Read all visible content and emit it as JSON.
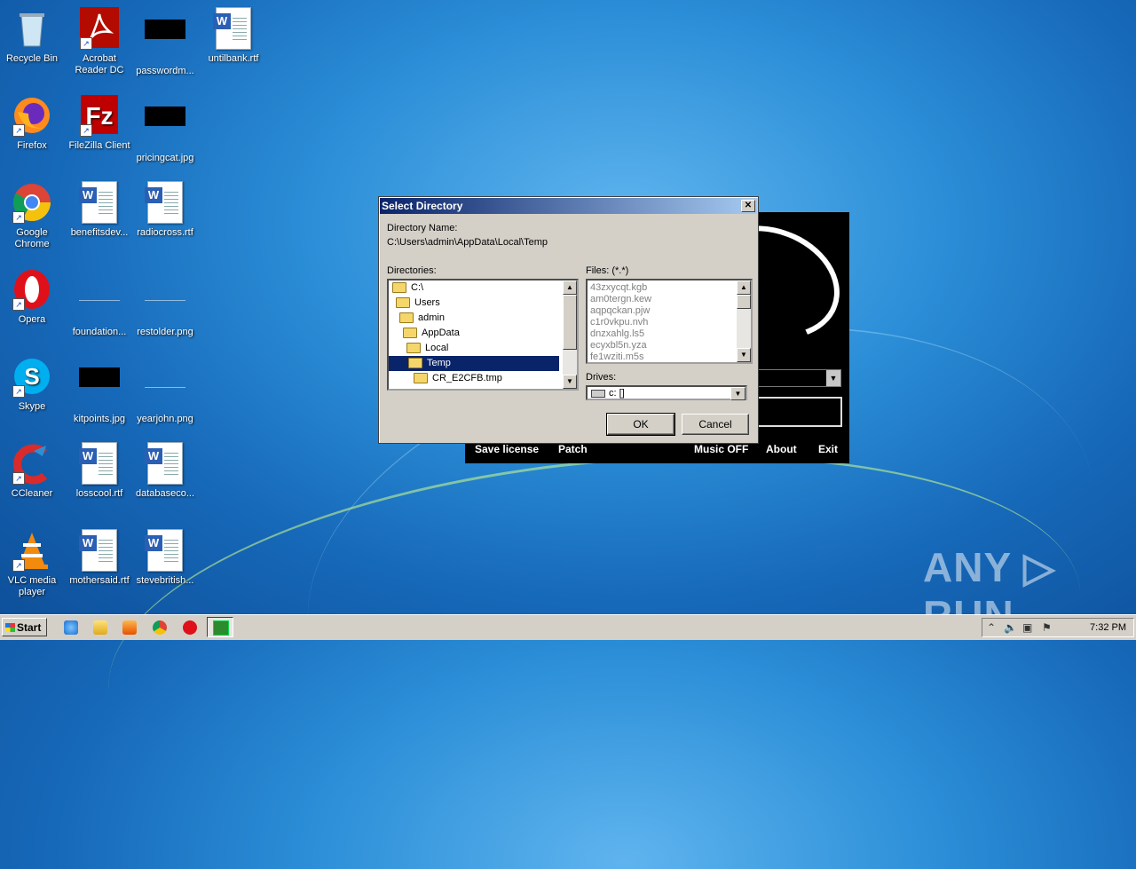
{
  "desktop": {
    "icons": [
      {
        "label": "Recycle Bin"
      },
      {
        "label": "Acrobat Reader DC"
      },
      {
        "label": "passwordm..."
      },
      {
        "label": "untilbank.rtf"
      },
      {
        "label": "Firefox"
      },
      {
        "label": "FileZilla Client"
      },
      {
        "label": "pricingcat.jpg"
      },
      {
        "label": "Google Chrome"
      },
      {
        "label": "benefitsdev..."
      },
      {
        "label": "radiocross.rtf"
      },
      {
        "label": "Opera"
      },
      {
        "label": "foundation..."
      },
      {
        "label": "restolder.png"
      },
      {
        "label": "Skype"
      },
      {
        "label": "kitpoints.jpg"
      },
      {
        "label": "yearjohn.png"
      },
      {
        "label": "CCleaner"
      },
      {
        "label": "losscool.rtf"
      },
      {
        "label": "databaseco..."
      },
      {
        "label": "VLC media player"
      },
      {
        "label": "mothersaid.rtf"
      },
      {
        "label": "stevebritish..."
      }
    ]
  },
  "patcher": {
    "buttons": {
      "save_license": "Save license",
      "patch": "Patch",
      "music": "Music OFF",
      "about": "About",
      "exit": "Exit"
    }
  },
  "dialog": {
    "title": "Select Directory",
    "close": "✕",
    "directory_name_label": "Directory Name:",
    "directory_path": "C:\\Users\\admin\\AppData\\Local\\Temp",
    "directories_label": "Directories:",
    "files_label": "Files: (*.*)",
    "drives_label": "Drives:",
    "directories": [
      {
        "name": "C:\\"
      },
      {
        "name": "Users"
      },
      {
        "name": "admin"
      },
      {
        "name": "AppData"
      },
      {
        "name": "Local"
      },
      {
        "name": "Temp"
      },
      {
        "name": "CR_E2CFB.tmp"
      }
    ],
    "selected_directory": "Temp",
    "files": [
      "43zxycqt.kgb",
      "am0tergn.kew",
      "aqpqckan.pjw",
      "c1r0vkpu.nvh",
      "dnzxahlg.ls5",
      "ecyxbl5n.yza",
      "fe1wziti.m5s"
    ],
    "drive_value": "c: []",
    "ok": "OK",
    "cancel": "Cancel"
  },
  "taskbar": {
    "start": "Start",
    "clock": "7:32 PM",
    "quick_launch": [
      "internet-explorer-icon",
      "explorer-icon",
      "media-player-icon",
      "chrome-icon",
      "opera-icon"
    ]
  },
  "watermark": "ANY ▷ RUN"
}
